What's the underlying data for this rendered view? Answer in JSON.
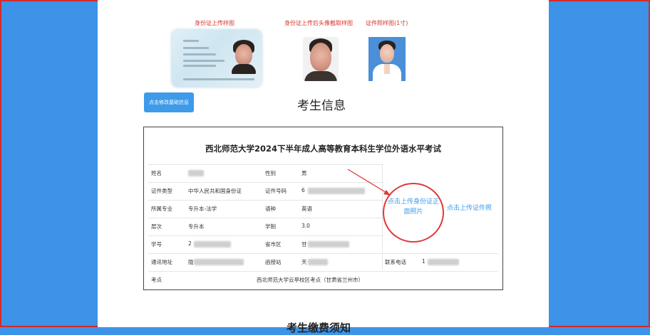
{
  "captions": {
    "idcard": "身份证上传样图",
    "headshot": "身份证上传后头像截取样图",
    "photo": "证件照样图(1寸)"
  },
  "edit_button": "点击修改基础信息",
  "section_title": "考生信息",
  "exam_title": "西北师范大学2024下半年成人高等教育本科生学位外语水平考试",
  "rows": {
    "name_label": "姓名",
    "name_value": "",
    "gender_label": "性别",
    "gender_value": "男",
    "idtype_label": "证件类型",
    "idtype_value": "中华人民共和国身份证",
    "idno_label": "证件号码",
    "idno_value": "6",
    "major_label": "所属专业",
    "major_value": "专升本-法学",
    "lang_label": "语种",
    "lang_value": "英语",
    "level_label": "层次",
    "level_value": "专升本",
    "duration_label": "学制",
    "duration_value": "3.0",
    "studentno_label": "学号",
    "studentno_value": "2",
    "province_label": "省市区",
    "province_value": "甘",
    "address_label": "通讯地址",
    "address_value": "陇",
    "post_label": "函授站",
    "post_value": "天",
    "phone_label": "联系电话",
    "phone_value": "1",
    "site_label": "考点",
    "site_value": "西北师范大学云亭校区考点（甘肃省兰州市）"
  },
  "upload_id_label": "点击上传身份证正面照片",
  "upload_photo_label": "点击上传证件照",
  "footer_title": "考生缴费须知",
  "colors": {
    "accent": "#3d9be9",
    "annotation": "#e03a3a",
    "side_bg": "#3d93e8"
  }
}
